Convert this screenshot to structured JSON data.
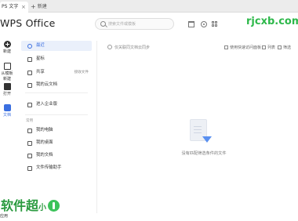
{
  "tabbar": {
    "active_tab": "PS 文字",
    "new_tab": "新建"
  },
  "header": {
    "logo": "WPS Office",
    "search_placeholder": "搜索文件或模板"
  },
  "watermark": {
    "top": "rjcxb.com",
    "bottom": "软件超",
    "bottom_small": "小"
  },
  "rail": {
    "items": [
      {
        "label": "新建",
        "icon": "plus-circle-icon"
      },
      {
        "label": "从模板新建",
        "icon": "template-icon"
      },
      {
        "label": "打开",
        "icon": "folder-icon"
      },
      {
        "label": "文档",
        "icon": "document-icon",
        "active": true
      }
    ],
    "bottom_label": "应用"
  },
  "nav": {
    "items": [
      {
        "label": "最近",
        "selected": true
      },
      {
        "label": "星标"
      },
      {
        "label": "共享",
        "side": "接收文件"
      },
      {
        "label": "我的云文档"
      },
      {
        "label": "进入企业版"
      }
    ],
    "section_label": "常用",
    "locations": [
      {
        "label": "我的电脑"
      },
      {
        "label": "我的桌面"
      },
      {
        "label": "我的文档"
      },
      {
        "label": "文件传输助手"
      }
    ]
  },
  "main": {
    "filter_label": "仅关联同文档云同步",
    "top_actions": [
      "使用快速访问面板",
      "列表",
      "筛选"
    ],
    "empty_text": "没有匹配筛选条件的文件"
  },
  "colors": {
    "accent": "#3b6fe0",
    "watermark_green": "#2db84a",
    "selected_bg": "#eaf0fb"
  }
}
